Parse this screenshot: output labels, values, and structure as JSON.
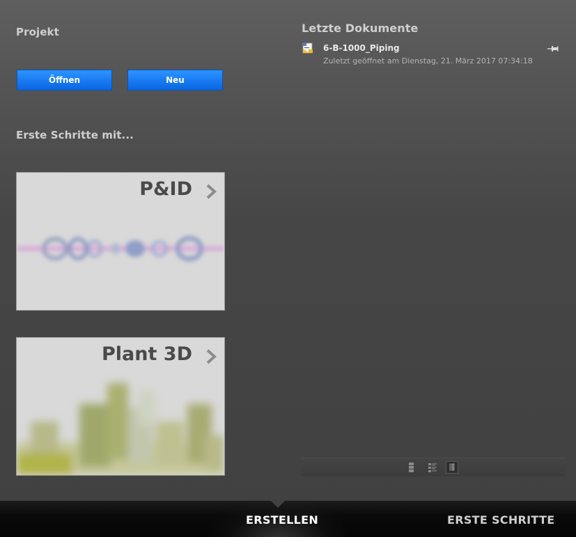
{
  "project": {
    "title": "Projekt",
    "open_label": "Öffnen",
    "new_label": "Neu"
  },
  "getting_started": {
    "title": "Erste Schritte mit...",
    "cards": [
      {
        "label": "P&ID",
        "icon": "chevron-right-icon"
      },
      {
        "label": "Plant 3D",
        "icon": "chevron-right-icon"
      }
    ]
  },
  "recent": {
    "title": "Letzte Dokumente",
    "items": [
      {
        "name": "6-B-1000_Piping",
        "subtitle": "Zuletzt geöffnet am Dienstag, 21. März 2017 07:34:18",
        "icon": "document-icon",
        "pin_icon": "pin-icon"
      }
    ],
    "view_modes": [
      "large-icons",
      "details",
      "list"
    ],
    "selected_view": "list"
  },
  "tabs": [
    {
      "label": "ERSTELLEN",
      "active": true
    },
    {
      "label": "ERSTE SCHRITTE",
      "active": false
    }
  ],
  "colors": {
    "button_blue": "#1a7cf3",
    "background": "#4a4a4a",
    "bottom_bar": "#0a0a0a"
  }
}
